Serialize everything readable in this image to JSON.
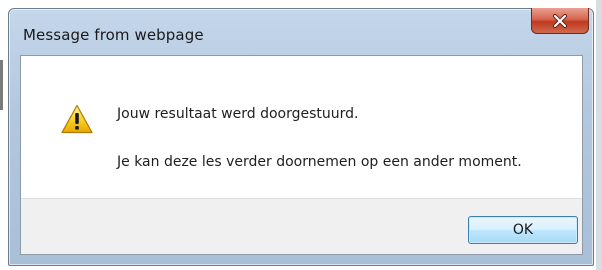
{
  "dialog": {
    "title": "Message from webpage",
    "close_icon": "close-x-icon",
    "close_color": "#c0391f",
    "message_icon": "warning-icon",
    "message_lines": [
      "Jouw resultaat werd doorgestuurd.",
      "Je kan deze les verder doornemen op een ander moment."
    ],
    "ok_label": "OK"
  }
}
